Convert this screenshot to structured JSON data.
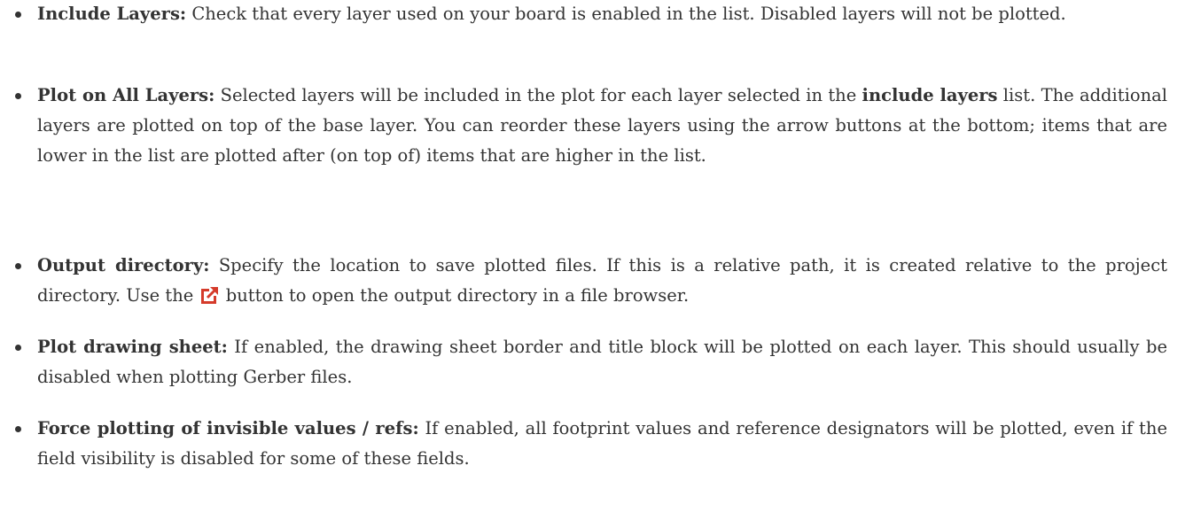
{
  "items": [
    {
      "term": "Include Layers:",
      "text": " Check that every layer used on your board is enabled in the list. Disabled layers will not be plotted."
    },
    {
      "term": "Plot on All Layers:",
      "text_a": " Selected layers will be included in the plot for each layer selected in the ",
      "bold_ref": "include layers",
      "text_b": " list. The additional layers are plotted on top of the base layer. You can reorder these layers using the arrow buttons at the bottom; items that are lower in the list are plotted after (on top of) items that are higher in the list."
    },
    {
      "term": "Output directory:",
      "text_a": " Specify the location to save plotted files. If this is a relative path, it is created relative to the project directory. Use the ",
      "icon": "open-external-icon",
      "text_b": " button to open the output directory in a file browser."
    },
    {
      "term": "Plot drawing sheet:",
      "text": " If enabled, the drawing sheet border and title block will be plotted on each layer. This should usually be disabled when plotting Gerber files."
    },
    {
      "term": "Force plotting of invisible values / refs:",
      "text": " If enabled, all footprint values and reference designators will be plotted, even if the field visibility is disabled for some of these fields."
    }
  ],
  "colors": {
    "text": "#333333",
    "icon": "#d53b2b"
  }
}
